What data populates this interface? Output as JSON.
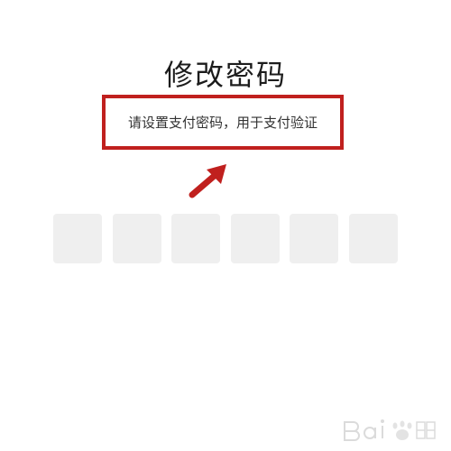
{
  "page": {
    "title": "修改密码",
    "hint": "请设置支付密码，用于支付验证"
  },
  "pin_input": {
    "cell_count": 6,
    "filled": 0,
    "cell_color": "#efefef"
  },
  "annotation": {
    "box_color": "#c0201e",
    "arrow_color": "#c0201e"
  },
  "watermark": {
    "icon": "baidu-jingyan-watermark"
  }
}
